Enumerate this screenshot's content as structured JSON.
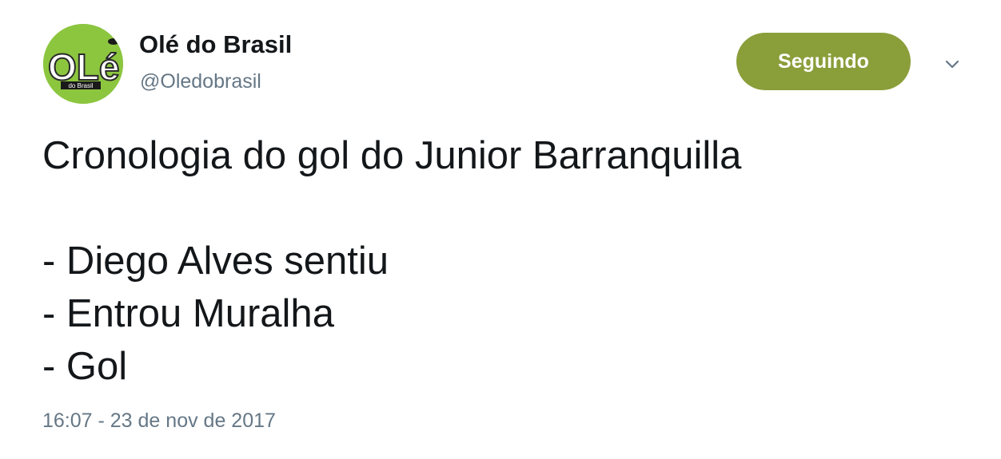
{
  "author": {
    "display_name": "Olé do Brasil",
    "handle": "@Oledobrasil",
    "avatar_logo_text": "OLé",
    "avatar_sub_text": "do Brasil"
  },
  "follow_button": {
    "label": "Seguindo",
    "color": "#8a9e3a"
  },
  "menu": {
    "icon": "chevron-down-icon"
  },
  "tweet": {
    "lines": [
      "Cronologia do gol do Junior Barranquilla",
      "",
      "- Diego Alves sentiu",
      "- Entrou Muralha",
      "- Gol"
    ],
    "timestamp": "16:07 - 23 de nov de 2017"
  },
  "colors": {
    "text": "#14171a",
    "secondary": "#657786",
    "avatar_bg": "#8cc63f"
  }
}
